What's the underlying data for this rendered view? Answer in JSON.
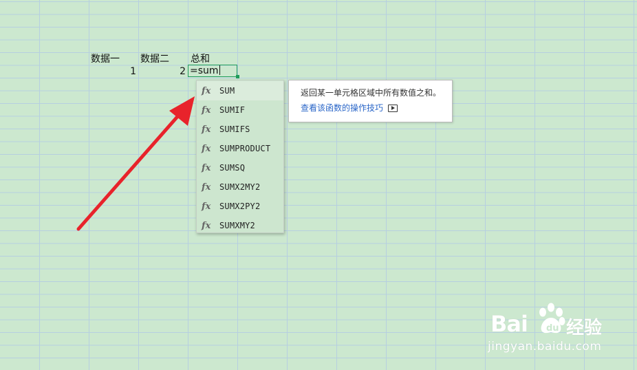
{
  "sheet": {
    "headers": [
      "数据一",
      "数据二",
      "总和"
    ],
    "row2": {
      "a": "1",
      "b": "2",
      "formula": "=sum"
    }
  },
  "autocomplete": {
    "icon_label": "fx",
    "items": [
      {
        "name": "SUM"
      },
      {
        "name": "SUMIF"
      },
      {
        "name": "SUMIFS"
      },
      {
        "name": "SUMPRODUCT"
      },
      {
        "name": "SUMSQ"
      },
      {
        "name": "SUMX2MY2"
      },
      {
        "name": "SUMX2PY2"
      },
      {
        "name": "SUMXMY2"
      }
    ],
    "selected_index": 0
  },
  "tooltip": {
    "description": "返回某一单元格区域中所有数值之和。",
    "link": "查看该函数的操作技巧"
  },
  "watermark": {
    "logo": "Bai",
    "logo_suffix": "经验",
    "url": "jingyan.baidu.com"
  },
  "colors": {
    "background": "#cce8cf",
    "arrow": "#e8232b",
    "active_cell_border": "#1e9c5a",
    "link": "#2a66c8"
  }
}
